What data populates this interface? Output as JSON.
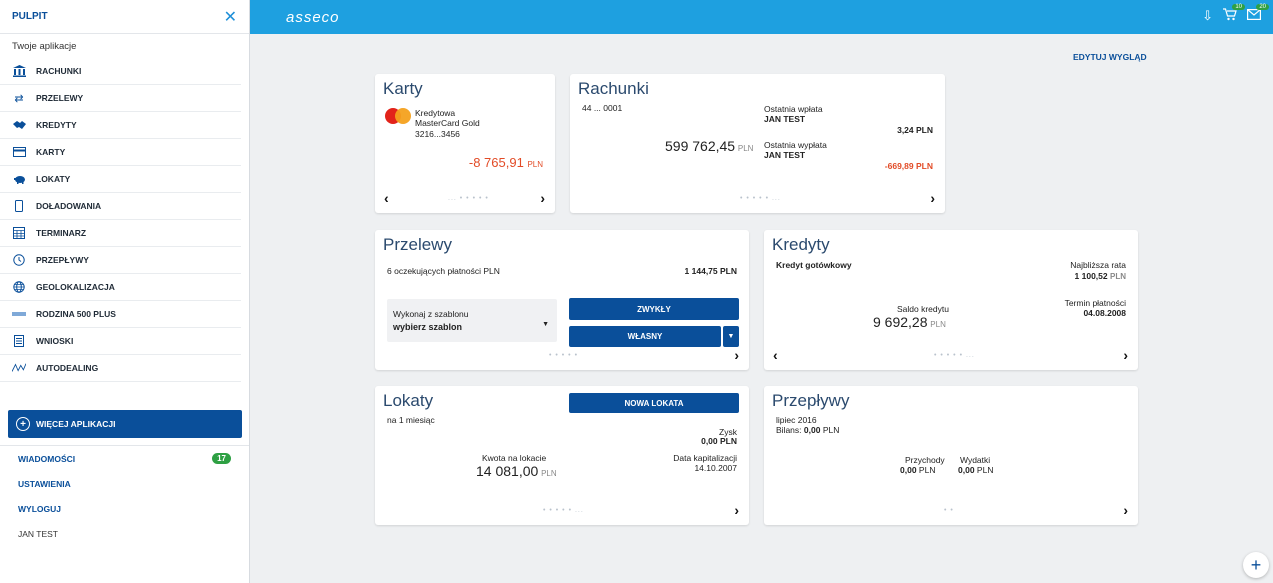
{
  "sidebar": {
    "title": "PULPIT",
    "subtitle": "Twoje aplikacje",
    "items": [
      {
        "label": "RACHUNKI",
        "icon": "bank-icon"
      },
      {
        "label": "PRZELEWY",
        "icon": "transfer-icon"
      },
      {
        "label": "KREDYTY",
        "icon": "handshake-icon"
      },
      {
        "label": "KARTY",
        "icon": "card-icon"
      },
      {
        "label": "LOKATY",
        "icon": "piggy-icon"
      },
      {
        "label": "DOŁADOWANIA",
        "icon": "phone-icon"
      },
      {
        "label": "TERMINARZ",
        "icon": "calendar-icon"
      },
      {
        "label": "PRZEPŁYWY",
        "icon": "clock-icon"
      },
      {
        "label": "GEOLOKALIZACJA",
        "icon": "globe-icon"
      },
      {
        "label": "RODZINA 500 PLUS",
        "icon": "family500-icon"
      },
      {
        "label": "WNIOSKI",
        "icon": "document-icon"
      },
      {
        "label": "AUTODEALING",
        "icon": "chart-line-icon"
      }
    ],
    "more_label": "WIĘCEJ APLIKACJI",
    "links": {
      "messages": "WIADOMOŚCI",
      "messages_count": "17",
      "settings": "USTAWIENIA",
      "logout": "WYLOGUJ",
      "user": "JAN TEST"
    }
  },
  "topbar": {
    "logo": "asseco",
    "cart_count": "10",
    "mail_count": "20"
  },
  "main": {
    "edit_view": "EDYTUJ WYGLĄD",
    "cards": {
      "karty": {
        "title": "Karty",
        "type": "Kredytowa",
        "name": "MasterCard Gold",
        "number": "3216...3456",
        "amount": "-8 765,91",
        "currency": "PLN",
        "dots": "... • • • • •"
      },
      "rachunki": {
        "title": "Rachunki",
        "account": "44 ... 0001",
        "balance": "599 762,45",
        "currency": "PLN",
        "last_in_label": "Ostatnia wpłata",
        "last_in_name": "JAN TEST",
        "last_in_amount": "3,24 PLN",
        "last_out_label": "Ostatnia wypłata",
        "last_out_name": "JAN TEST",
        "last_out_amount": "-669,89 PLN",
        "dots": "• • • • • ..."
      },
      "przelewy": {
        "title": "Przelewy",
        "pending": "6 oczekujących płatności PLN",
        "pending_amount": "1 144,75 PLN",
        "template_label": "Wykonaj z szablonu",
        "template_value": "wybierz szablon",
        "btn_normal": "ZWYKŁY",
        "btn_own": "WŁASNY",
        "dots": "• • • • •"
      },
      "kredyty": {
        "title": "Kredyty",
        "type": "Kredyt gotówkowy",
        "next_label": "Najbliższa rata",
        "next_amount": "1 100,52",
        "next_currency": "PLN",
        "balance_label": "Saldo kredytu",
        "balance": "9 692,28",
        "balance_currency": "PLN",
        "due_label": "Termin płatności",
        "due_date": "04.08.2008",
        "dots": "• • • • • ..."
      },
      "lokaty": {
        "title": "Lokaty",
        "btn_new": "NOWA LOKATA",
        "period": "na 1 miesiąc",
        "profit_label": "Zysk",
        "profit_value": "0,00 PLN",
        "amount_label": "Kwota na lokacie",
        "amount": "14 081,00",
        "currency": "PLN",
        "cap_label": "Data kapitalizacji",
        "cap_date": "14.10.2007",
        "dots": "• • • • • ..."
      },
      "przeplywy": {
        "title": "Przepływy",
        "month": "lipiec 2016",
        "balance_label": "Bilans:",
        "balance_value": "0,00",
        "balance_currency": "PLN",
        "income_label": "Przychody",
        "income_value": "0,00",
        "income_currency": "PLN",
        "expense_label": "Wydatki",
        "expense_value": "0,00",
        "expense_currency": "PLN",
        "dots": "• •"
      }
    }
  },
  "colors": {
    "topbar": "#1ea0e0",
    "primary": "#0a4f9a",
    "negative": "#e24b26",
    "badge": "#2ea043"
  }
}
